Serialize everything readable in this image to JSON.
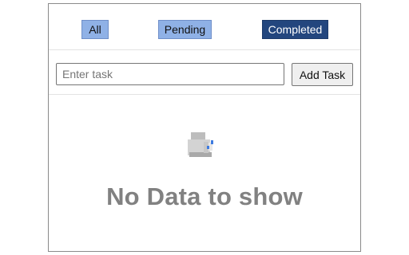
{
  "filters": {
    "all_label": "All",
    "pending_label": "Pending",
    "completed_label": "Completed",
    "active": "Completed"
  },
  "task_form": {
    "input_value": "",
    "input_placeholder": "Enter task",
    "add_label": "Add Task"
  },
  "empty_state": {
    "icon": "empty-box-icon",
    "message": "No Data to show"
  },
  "colors": {
    "filter_inactive_bg": "#8fb1e6",
    "filter_active_bg": "#23467e",
    "empty_text": "#818181"
  }
}
